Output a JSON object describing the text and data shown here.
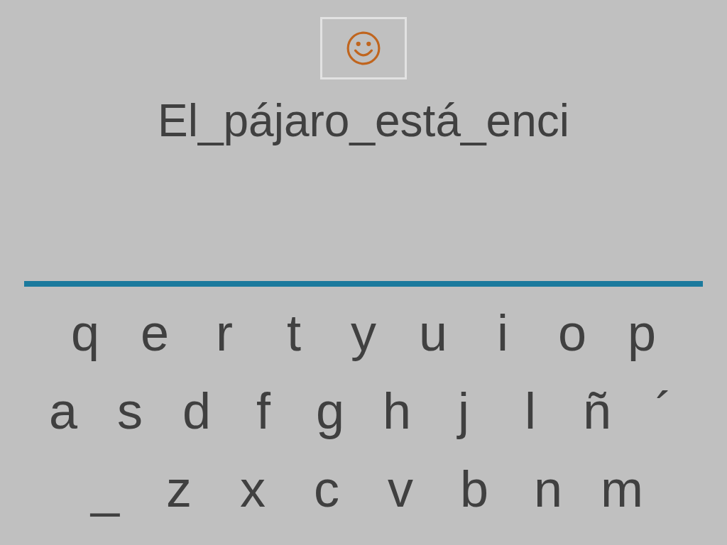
{
  "phrase": "El_pájaro_está_enci",
  "keyboard": {
    "rows": [
      [
        "q",
        "e",
        "r",
        "t",
        "y",
        "u",
        "i",
        "o",
        "p"
      ],
      [
        "a",
        "s",
        "d",
        "f",
        "g",
        "h",
        "j",
        "l",
        "ñ",
        "´"
      ],
      [
        "_",
        "z",
        "x",
        "c",
        "v",
        "b",
        "n",
        "m"
      ]
    ]
  }
}
